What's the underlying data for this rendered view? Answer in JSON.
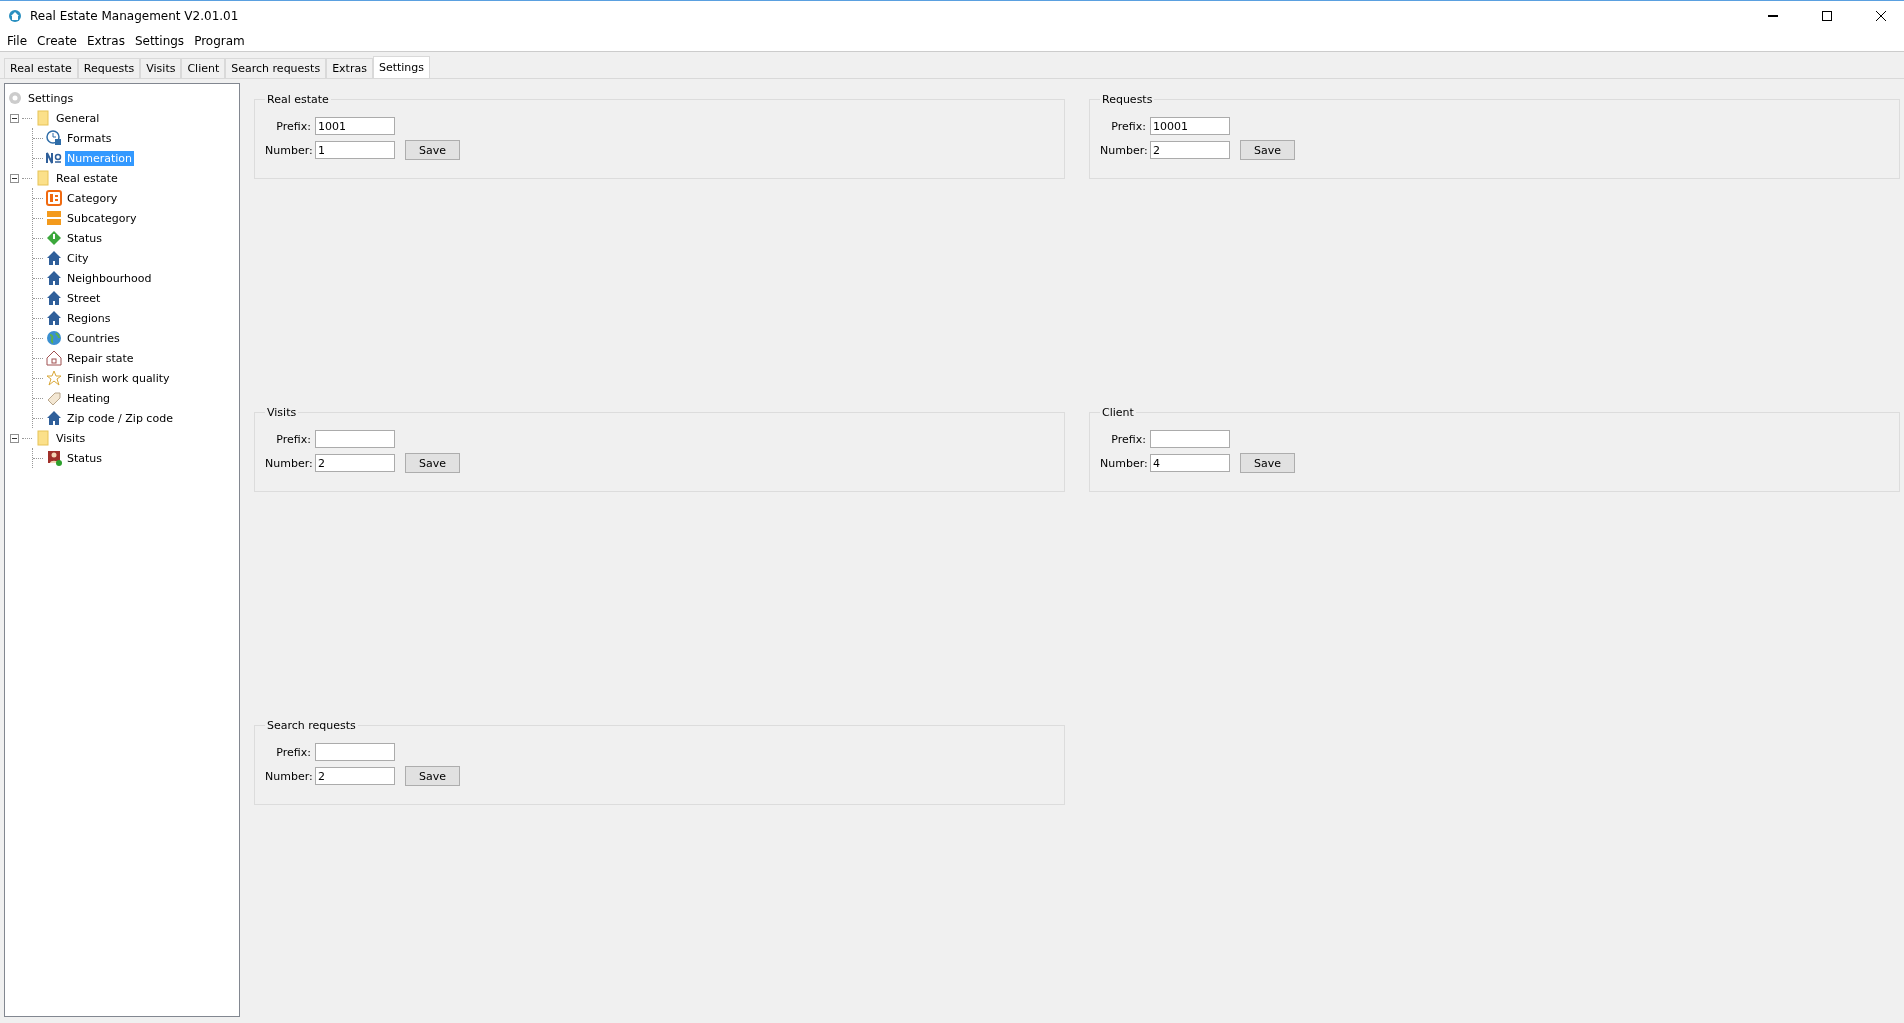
{
  "window": {
    "title": "Real Estate Management V2.01.01"
  },
  "menu": [
    "File",
    "Create",
    "Extras",
    "Settings",
    "Program"
  ],
  "tabs": [
    {
      "label": "Real estate",
      "selected": false
    },
    {
      "label": "Requests",
      "selected": false
    },
    {
      "label": "Visits",
      "selected": false
    },
    {
      "label": "Client",
      "selected": false
    },
    {
      "label": "Search requests",
      "selected": false
    },
    {
      "label": "Extras",
      "selected": false
    },
    {
      "label": "Settings",
      "selected": true
    }
  ],
  "tree": {
    "label": "Settings",
    "kind": "gear",
    "children": [
      {
        "label": "General",
        "kind": "folder",
        "expanded": true,
        "selected": false,
        "children": [
          {
            "label": "Formats",
            "kind": "clock",
            "selected": false
          },
          {
            "label": "Numeration",
            "kind": "number",
            "selected": true
          }
        ]
      },
      {
        "label": "Real estate",
        "kind": "folder",
        "expanded": true,
        "selected": false,
        "children": [
          {
            "label": "Category",
            "kind": "category",
            "selected": false
          },
          {
            "label": "Subcategory",
            "kind": "subfolders",
            "selected": false
          },
          {
            "label": "Status",
            "kind": "diamond",
            "selected": false
          },
          {
            "label": "City",
            "kind": "house",
            "selected": false
          },
          {
            "label": "Neighbourhood",
            "kind": "house",
            "selected": false
          },
          {
            "label": "Street",
            "kind": "house",
            "selected": false
          },
          {
            "label": "Regions",
            "kind": "house",
            "selected": false
          },
          {
            "label": "Countries",
            "kind": "globe",
            "selected": false
          },
          {
            "label": "Repair state",
            "kind": "outline-house",
            "selected": false
          },
          {
            "label": "Finish work quality",
            "kind": "star",
            "selected": false
          },
          {
            "label": "Heating",
            "kind": "tag",
            "selected": false
          },
          {
            "label": "Zip code / Zip code",
            "kind": "house",
            "selected": false
          }
        ]
      },
      {
        "label": "Visits",
        "kind": "folder",
        "expanded": true,
        "selected": false,
        "children": [
          {
            "label": "Status",
            "kind": "person",
            "selected": false
          }
        ]
      }
    ]
  },
  "groups": [
    {
      "title": "Real estate",
      "prefix_label": "Prefix:",
      "prefix": "1001",
      "number_label": "Number:",
      "number": "1",
      "button": "Save"
    },
    {
      "title": "Requests",
      "prefix_label": "Prefix:",
      "prefix": "10001",
      "number_label": "Number:",
      "number": "2",
      "button": "Save"
    },
    {
      "title": "Visits",
      "prefix_label": "Prefix:",
      "number_label": "Number:",
      "number": "2",
      "button": "Save"
    },
    {
      "title": "Client",
      "prefix_label": "Prefix:",
      "number_label": "Number:",
      "number": "4",
      "button": "Save"
    },
    {
      "title": "Search requests",
      "prefix_label": "Prefix:",
      "number_label": "Number:",
      "number": "2",
      "button": "Save"
    }
  ]
}
